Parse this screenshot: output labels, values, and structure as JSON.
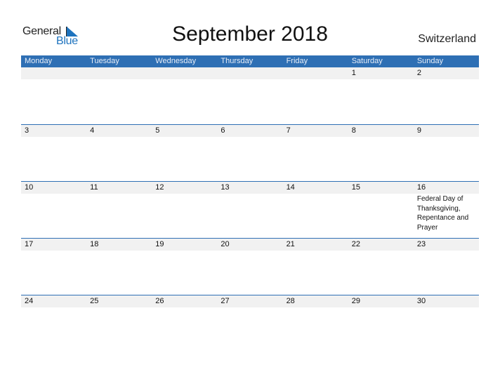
{
  "logo": {
    "word1": "General",
    "word2": "Blue"
  },
  "title": "September 2018",
  "country": "Switzerland",
  "colors": {
    "accent": "#2e6fb4",
    "strip": "#f1f1f1"
  },
  "weekdays": [
    "Monday",
    "Tuesday",
    "Wednesday",
    "Thursday",
    "Friday",
    "Saturday",
    "Sunday"
  ],
  "weeks": [
    {
      "days": [
        {
          "n": "",
          "e": ""
        },
        {
          "n": "",
          "e": ""
        },
        {
          "n": "",
          "e": ""
        },
        {
          "n": "",
          "e": ""
        },
        {
          "n": "",
          "e": ""
        },
        {
          "n": "1",
          "e": ""
        },
        {
          "n": "2",
          "e": ""
        }
      ]
    },
    {
      "days": [
        {
          "n": "3",
          "e": ""
        },
        {
          "n": "4",
          "e": ""
        },
        {
          "n": "5",
          "e": ""
        },
        {
          "n": "6",
          "e": ""
        },
        {
          "n": "7",
          "e": ""
        },
        {
          "n": "8",
          "e": ""
        },
        {
          "n": "9",
          "e": ""
        }
      ]
    },
    {
      "days": [
        {
          "n": "10",
          "e": ""
        },
        {
          "n": "11",
          "e": ""
        },
        {
          "n": "12",
          "e": ""
        },
        {
          "n": "13",
          "e": ""
        },
        {
          "n": "14",
          "e": ""
        },
        {
          "n": "15",
          "e": ""
        },
        {
          "n": "16",
          "e": "Federal Day of Thanksgiving, Repentance and Prayer"
        }
      ]
    },
    {
      "days": [
        {
          "n": "17",
          "e": ""
        },
        {
          "n": "18",
          "e": ""
        },
        {
          "n": "19",
          "e": ""
        },
        {
          "n": "20",
          "e": ""
        },
        {
          "n": "21",
          "e": ""
        },
        {
          "n": "22",
          "e": ""
        },
        {
          "n": "23",
          "e": ""
        }
      ]
    },
    {
      "days": [
        {
          "n": "24",
          "e": ""
        },
        {
          "n": "25",
          "e": ""
        },
        {
          "n": "26",
          "e": ""
        },
        {
          "n": "27",
          "e": ""
        },
        {
          "n": "28",
          "e": ""
        },
        {
          "n": "29",
          "e": ""
        },
        {
          "n": "30",
          "e": ""
        }
      ]
    }
  ]
}
